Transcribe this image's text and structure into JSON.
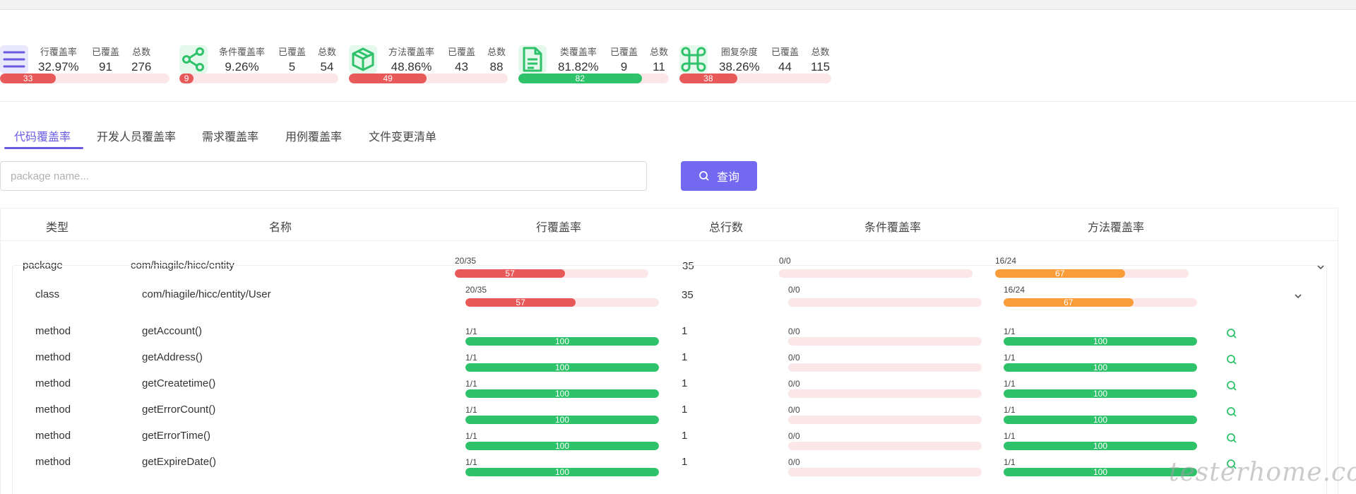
{
  "colors": {
    "accent": "#6a5ae0",
    "button": "#7369f0",
    "red": "#e85a5a",
    "green": "#2ec26a",
    "orange": "#fa9c3a",
    "track": "#fbe7e7"
  },
  "stats": [
    {
      "icon": "menu-icon",
      "rate_label": "行覆盖率",
      "rate": "32.97%",
      "covered_label": "已覆盖",
      "covered": "91",
      "total_label": "总数",
      "total": "276",
      "percent": 33,
      "bar_label": "33",
      "color": "#e85a5a"
    },
    {
      "icon": "share-icon",
      "rate_label": "条件覆盖率",
      "rate": "9.26%",
      "covered_label": "已覆盖",
      "covered": "5",
      "total_label": "总数",
      "total": "54",
      "percent": 9,
      "bar_label": "9",
      "color": "#e85a5a"
    },
    {
      "icon": "cube-icon",
      "rate_label": "方法覆盖率",
      "rate": "48.86%",
      "covered_label": "已覆盖",
      "covered": "43",
      "total_label": "总数",
      "total": "88",
      "percent": 49,
      "bar_label": "49",
      "color": "#e85a5a"
    },
    {
      "icon": "document-icon",
      "rate_label": "类覆盖率",
      "rate": "81.82%",
      "covered_label": "已覆盖",
      "covered": "9",
      "total_label": "总数",
      "total": "11",
      "percent": 82,
      "bar_label": "82",
      "color": "#2ec26a"
    },
    {
      "icon": "command-icon",
      "rate_label": "圈复杂度",
      "rate": "38.26%",
      "covered_label": "已覆盖",
      "covered": "44",
      "total_label": "总数",
      "total": "115",
      "percent": 38,
      "bar_label": "38",
      "color": "#e85a5a"
    }
  ],
  "tabs": [
    {
      "label": "代码覆盖率",
      "active": true
    },
    {
      "label": "开发人员覆盖率",
      "active": false
    },
    {
      "label": "需求覆盖率",
      "active": false
    },
    {
      "label": "用例覆盖率",
      "active": false
    },
    {
      "label": "文件变更清单",
      "active": false
    }
  ],
  "search": {
    "placeholder": "package name...",
    "button_label": "查询"
  },
  "table": {
    "headers": {
      "type": "类型",
      "name": "名称",
      "line_rate": "行覆盖率",
      "total_lines": "总行数",
      "cond_rate": "条件覆盖率",
      "method_rate": "方法覆盖率"
    },
    "package_row": {
      "type": "package",
      "name": "com/hiagile/hicc/entity",
      "line": {
        "text": "20/35",
        "percent": 57,
        "label": "57",
        "color": "#e85a5a"
      },
      "total": "35",
      "cond": {
        "text": "0/0",
        "percent": 0,
        "label": "",
        "color": "#e85a5a"
      },
      "method": {
        "text": "16/24",
        "percent": 67,
        "label": "67",
        "color": "#fa9c3a"
      }
    },
    "class_row": {
      "type": "class",
      "name": "com/hiagile/hicc/entity/User",
      "line": {
        "text": "20/35",
        "percent": 57,
        "label": "57",
        "color": "#e85a5a"
      },
      "total": "35",
      "cond": {
        "text": "0/0",
        "percent": 0,
        "label": "",
        "color": "#e85a5a"
      },
      "method": {
        "text": "16/24",
        "percent": 67,
        "label": "67",
        "color": "#fa9c3a"
      }
    },
    "method_rows": [
      {
        "type": "method",
        "name": "getAccount()",
        "line_text": "1/1",
        "line_percent": 100,
        "line_label": "100",
        "total": "1",
        "cond_text": "0/0",
        "method_text": "1/1",
        "method_percent": 100,
        "method_label": "100"
      },
      {
        "type": "method",
        "name": "getAddress()",
        "line_text": "1/1",
        "line_percent": 100,
        "line_label": "100",
        "total": "1",
        "cond_text": "0/0",
        "method_text": "1/1",
        "method_percent": 100,
        "method_label": "100"
      },
      {
        "type": "method",
        "name": "getCreatetime()",
        "line_text": "1/1",
        "line_percent": 100,
        "line_label": "100",
        "total": "1",
        "cond_text": "0/0",
        "method_text": "1/1",
        "method_percent": 100,
        "method_label": "100"
      },
      {
        "type": "method",
        "name": "getErrorCount()",
        "line_text": "1/1",
        "line_percent": 100,
        "line_label": "100",
        "total": "1",
        "cond_text": "0/0",
        "method_text": "1/1",
        "method_percent": 100,
        "method_label": "100"
      },
      {
        "type": "method",
        "name": "getErrorTime()",
        "line_text": "1/1",
        "line_percent": 100,
        "line_label": "100",
        "total": "1",
        "cond_text": "0/0",
        "method_text": "1/1",
        "method_percent": 100,
        "method_label": "100"
      },
      {
        "type": "method",
        "name": "getExpireDate()",
        "line_text": "1/1",
        "line_percent": 100,
        "line_label": "100",
        "total": "1",
        "cond_text": "0/0",
        "method_text": "1/1",
        "method_percent": 100,
        "method_label": "100"
      }
    ]
  },
  "watermark": "testerhome.com"
}
